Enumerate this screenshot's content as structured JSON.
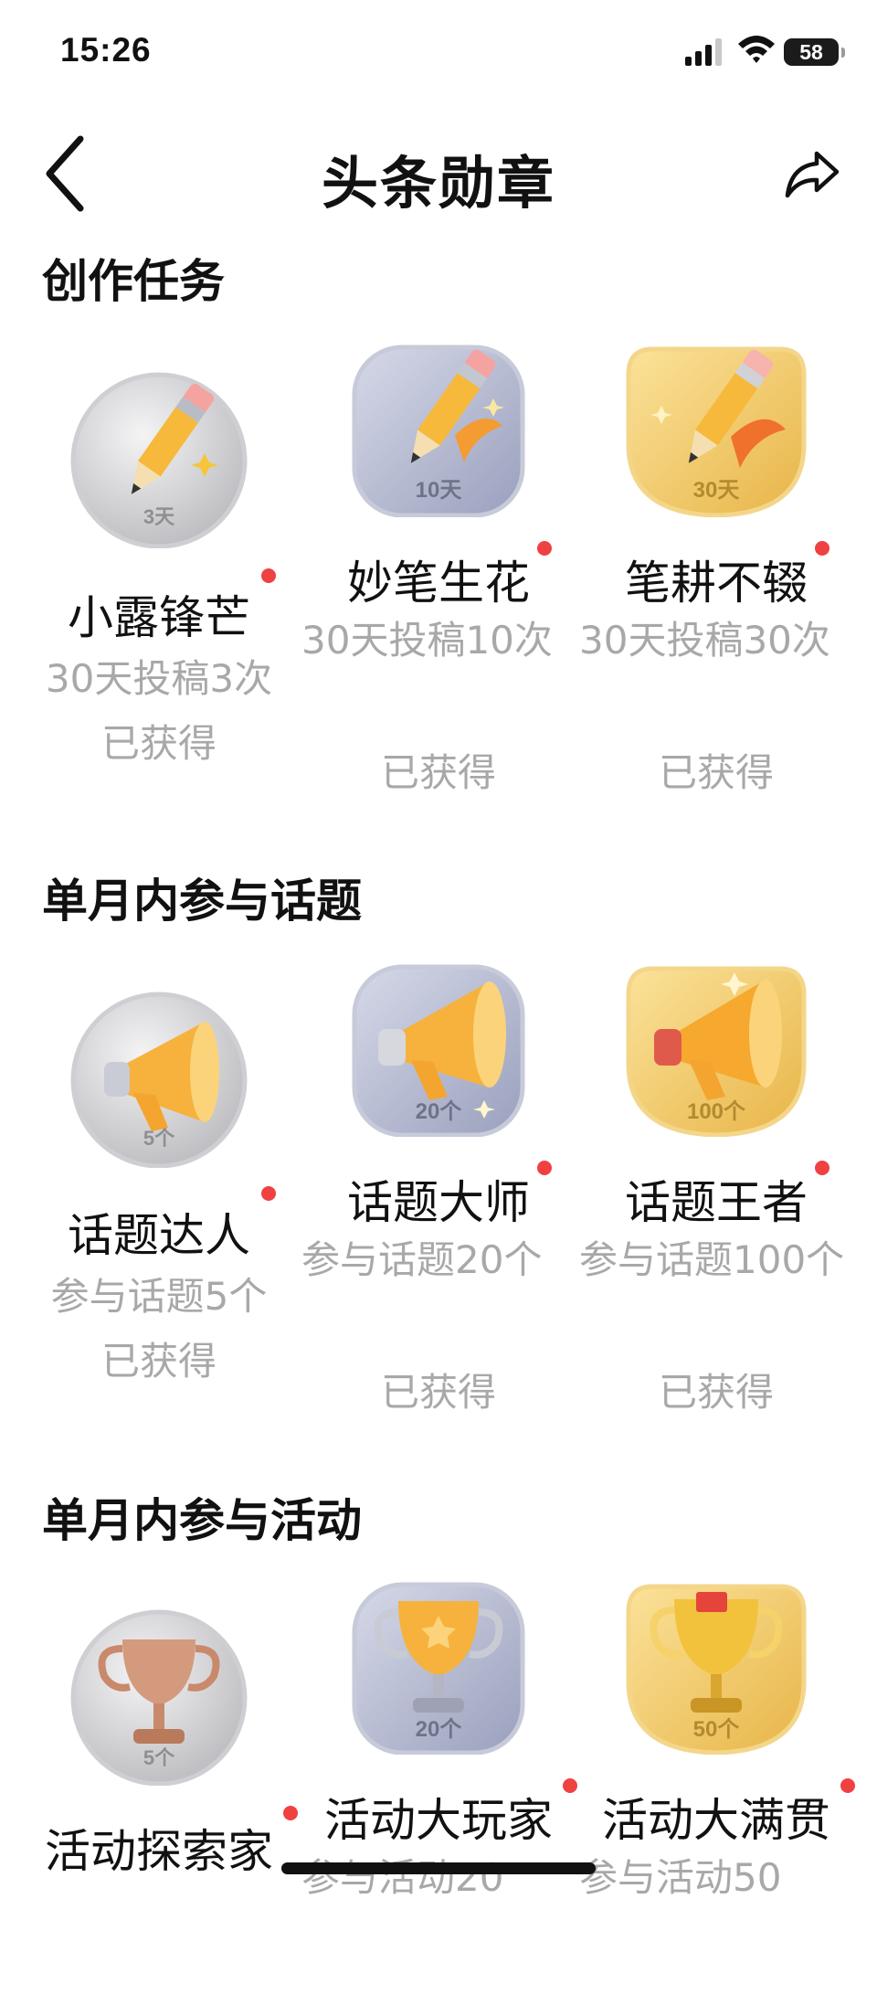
{
  "status_bar": {
    "time": "15:26",
    "battery": "58"
  },
  "header": {
    "title": "头条勋章"
  },
  "sections": [
    {
      "title": "创作任务",
      "medals": [
        {
          "name": "小露锋芒",
          "level": "3天",
          "requirement": "30天投稿3次",
          "status": "已获得"
        },
        {
          "name": "妙笔生花",
          "level": "10天",
          "requirement": "30天投稿10次",
          "status": "已获得"
        },
        {
          "name": "笔耕不辍",
          "level": "30天",
          "requirement": "30天投稿30次",
          "status": "已获得"
        }
      ]
    },
    {
      "title": "单月内参与话题",
      "medals": [
        {
          "name": "话题达人",
          "level": "5个",
          "requirement": "参与话题5个",
          "status": "已获得"
        },
        {
          "name": "话题大师",
          "level": "20个",
          "requirement": "参与话题20个",
          "status": "已获得"
        },
        {
          "name": "话题王者",
          "level": "100个",
          "requirement": "参与话题100个",
          "status": "已获得"
        }
      ]
    },
    {
      "title": "单月内参与活动",
      "medals": [
        {
          "name": "活动探索家",
          "level": "5个",
          "requirement": "",
          "status": ""
        },
        {
          "name": "活动大玩家",
          "level": "20个",
          "requirement": "参与活动20",
          "status": ""
        },
        {
          "name": "活动大满贯",
          "level": "50个",
          "requirement": "参与活动50",
          "status": ""
        }
      ]
    }
  ],
  "colors": {
    "accent_dot": "#f04142",
    "muted_text": "#a8a8a8",
    "silver": "#d7d7d9",
    "blue_gray": "#b6bad0",
    "gold": "#f3c766"
  }
}
